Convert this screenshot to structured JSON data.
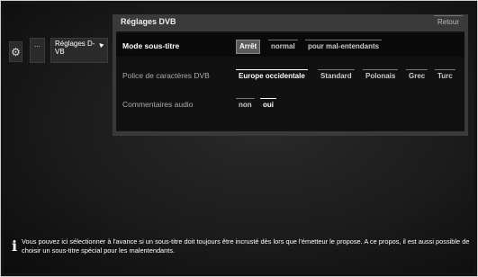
{
  "nav": {
    "gear_icon": "gear-icon",
    "more_label": "...",
    "breadcrumb_label": "Réglages D-VB",
    "breadcrumb_arrow": "▲"
  },
  "panel": {
    "title": "Réglages DVB",
    "back_label": "Retour",
    "rows": [
      {
        "label": "Mode sous-titre",
        "options": [
          "Arrêt",
          "normal",
          "pour mal-entendants"
        ],
        "selected": "Arrêt"
      },
      {
        "label": "Police de caractères DVB",
        "options": [
          "Europe occidentale",
          "Standard",
          "Polonais",
          "Grec",
          "Turc"
        ],
        "selected": "Europe occidentale"
      },
      {
        "label": "Commentaires audio",
        "options": [
          "non",
          "oui"
        ],
        "selected": "oui"
      }
    ]
  },
  "info": {
    "icon": "info-icon",
    "text": "Vous pouvez ici sélectionner à l'avance si un sous-titre doit toujours être incrusté dès lors que l'émetteur le propose. A ce propos, il est aussi possible de choisir un sous-titre spécial pour les malentendants."
  }
}
